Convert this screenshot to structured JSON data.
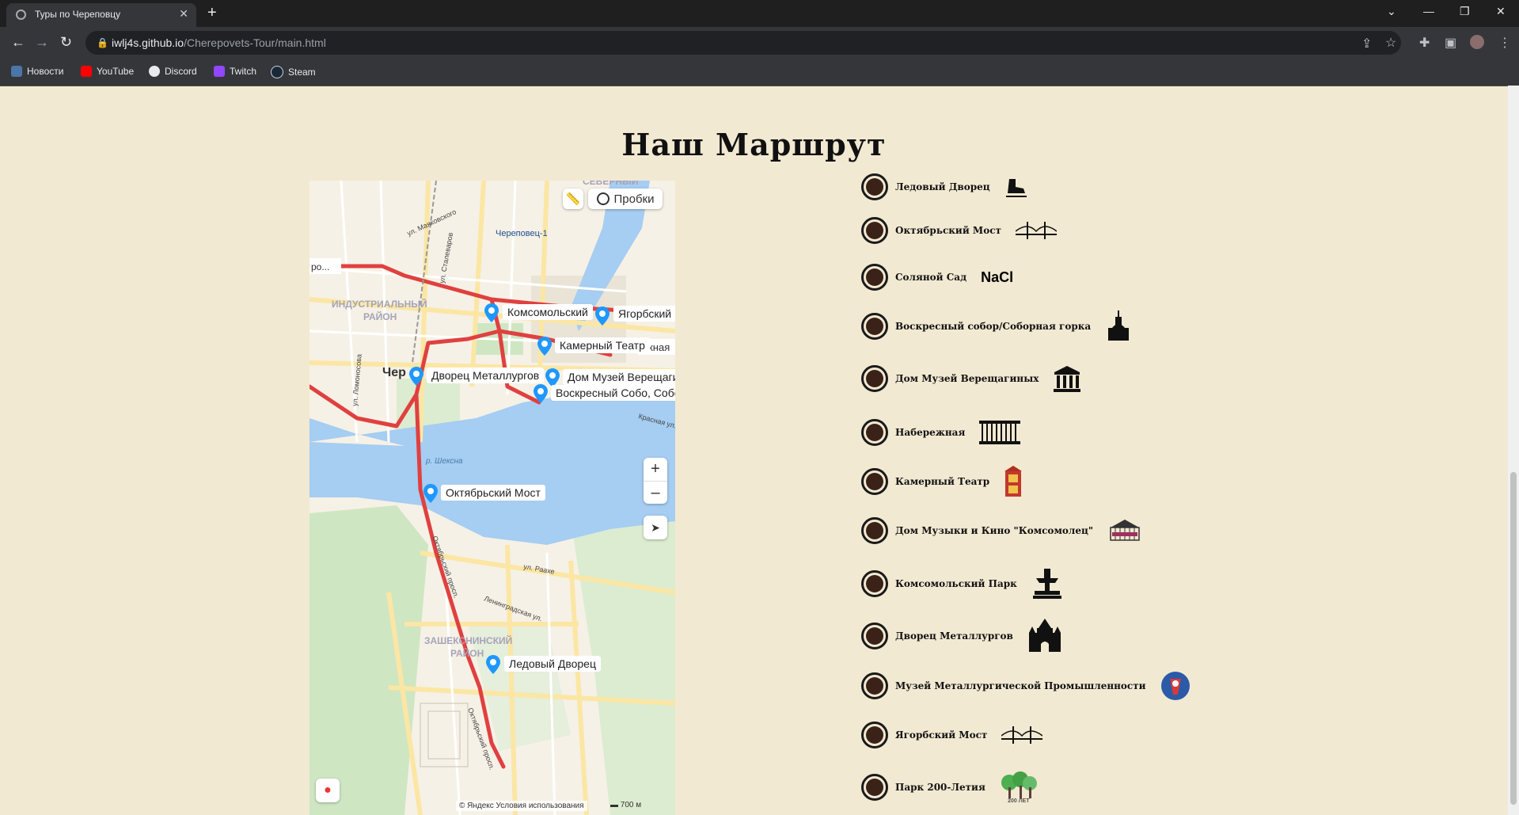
{
  "browser": {
    "tab_title": "Туры по Череповцу",
    "url_host": "iwlj4s.github.io",
    "url_path": "/Cherepovets-Tour/main.html",
    "bookmarks": [
      {
        "label": "Новости",
        "color": "#4a76a8"
      },
      {
        "label": "YouTube",
        "color": "#ff0000"
      },
      {
        "label": "Discord",
        "color": "#e8eaed"
      },
      {
        "label": "Twitch",
        "color": "#9146ff"
      },
      {
        "label": "Steam",
        "color": "#1b2838"
      }
    ]
  },
  "page": {
    "heading": "Наш Маршрут",
    "accent_color": "#3a2218",
    "background": "#f2e9d2"
  },
  "map": {
    "traffic_button": "Пробки",
    "zoom_in": "+",
    "zoom_out": "–",
    "copyright": "© Яндекс   Условия использования",
    "scale": "700 м",
    "places": [
      {
        "label": "Комсомольский"
      },
      {
        "label": "Ягорбский М"
      },
      {
        "label": "Камерный Театр"
      },
      {
        "label": "Дворец Металлургов"
      },
      {
        "label": "Дом Музей Верещаги"
      },
      {
        "label": "Воскресный Собо, Собо"
      },
      {
        "label": "Октябрьский Мост"
      },
      {
        "label": "Ледовый Дворец"
      }
    ],
    "districts": [
      "ИНДУСТРИАЛЬНЫЙ РАЙОН",
      "ЗАШЕКСНИНСКИЙ РАЙОН",
      "СЕВЕРНЫЙ"
    ],
    "streets": {
      "station": "Череповец-1",
      "river": "р. Шексна",
      "cut_label": "ро...",
      "city_cut": "Чер",
      "embankment_cut": "ожная"
    }
  },
  "route": [
    {
      "label": "Ледовый Дворец",
      "icon": "skate-icon"
    },
    {
      "label": "Октябрьский Мост",
      "icon": "bridge-icon"
    },
    {
      "label": "Соляной Сад",
      "icon": "nacl-icon",
      "icon_text": "NaCl"
    },
    {
      "label": "Воскресный собор/Соборная горка",
      "icon": "cathedral-icon"
    },
    {
      "label": "Дом Музей Верещагиных",
      "icon": "museum-icon"
    },
    {
      "label": "Набережная",
      "icon": "railing-icon"
    },
    {
      "label": "Камерный Театр",
      "icon": "theater-icon"
    },
    {
      "label": "Дом Музыки и Кино \"Комсомолец\"",
      "icon": "cinema-icon"
    },
    {
      "label": "Комсомольский Парк",
      "icon": "fountain-icon"
    },
    {
      "label": "Дворец Металлургов",
      "icon": "palace-icon"
    },
    {
      "label": "Музей Металлургической Промышленности",
      "icon": "metallurgy-icon"
    },
    {
      "label": "Ягорбский Мост",
      "icon": "bridge-icon"
    },
    {
      "label": "Парк 200-Летия",
      "icon": "park-icon",
      "icon_text": "200 ЛЕТ"
    }
  ]
}
